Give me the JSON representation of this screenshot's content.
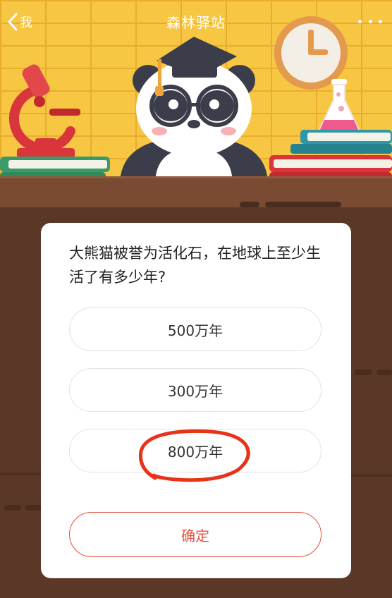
{
  "header": {
    "back_label": "我",
    "title": "森林驿站"
  },
  "quiz": {
    "question": "大熊猫被誉为活化石，在地球上至少生活了有多少年?",
    "options": [
      {
        "label": "500万年"
      },
      {
        "label": "300万年"
      },
      {
        "label": "800万年"
      }
    ],
    "marked_option": "800万年",
    "confirm_label": "确定"
  },
  "colors": {
    "wall": "#f7c744",
    "desk": "#5b3727",
    "accent": "#e4533f",
    "annotation": "#e8331b"
  },
  "icons": {
    "back": "chevron-left-icon",
    "more": "more-dots-icon",
    "panda": "panda-graduate-illustration",
    "microscope": "microscope-icon",
    "clock": "clock-icon",
    "flask": "flask-icon",
    "books": "books-icon"
  }
}
